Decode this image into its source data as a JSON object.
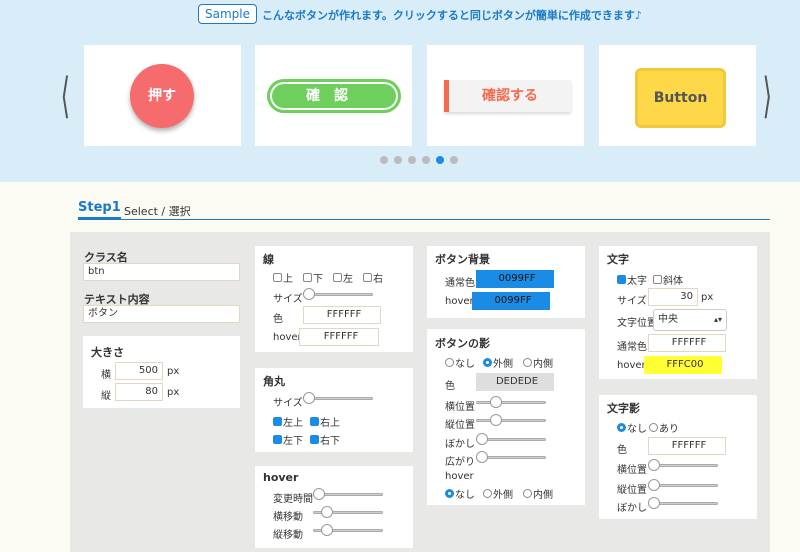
{
  "header": {
    "sample_tag": "Sample",
    "sample_text": "こんなボタンが作れます。クリックすると同じボタンが簡単に作成できます♪"
  },
  "carousel": {
    "prev": "〈",
    "next": "〉",
    "buttons": [
      "押す",
      "確認",
      "確認する",
      "Button"
    ],
    "dots": 6,
    "active_dot": 5
  },
  "step": {
    "number": "Step1",
    "title": "Select /  選択"
  },
  "class_box": {
    "class_label": "クラス名",
    "class_value": "btn",
    "text_label": "テキスト内容",
    "text_value": "ボタン"
  },
  "size_box": {
    "title": "大きさ",
    "width_label": "横",
    "width_value": "500",
    "height_label": "縦",
    "height_value": "80",
    "unit": "px"
  },
  "line_box": {
    "title": "線",
    "sides": [
      "上",
      "下",
      "左",
      "右"
    ],
    "size_label": "サイズ",
    "color_label": "色",
    "color_value": "FFFFFF",
    "hover_label": "hover",
    "hover_value": "FFFFFF"
  },
  "corner_box": {
    "title": "角丸",
    "size_label": "サイズ",
    "corners": [
      "左上",
      "右上",
      "左下",
      "右下"
    ]
  },
  "hover_box": {
    "title": "hover",
    "items": [
      "変更時間",
      "横移動",
      "縦移動"
    ]
  },
  "bg_box": {
    "title": "ボタン背景",
    "normal_label": "通常色",
    "normal_value": "0099FF",
    "hover_label": "hover",
    "hover_value": "0099FF",
    "accent": "#1a8ce5"
  },
  "shadow_box": {
    "title": "ボタンの影",
    "modes": [
      "なし",
      "外側",
      "内側"
    ],
    "color_label": "色",
    "color_value": "DEDEDE",
    "sliders": [
      "横位置",
      "縦位置",
      "ぼかし",
      "広がり"
    ],
    "hover_label": "hover",
    "hover_modes": [
      "なし",
      "外側",
      "内側"
    ]
  },
  "text_box": {
    "title": "文字",
    "bold_label": "太字",
    "italic_label": "斜体",
    "size_label": "サイズ",
    "size_value": "30",
    "unit": "px",
    "align_label": "文字位置",
    "align_value": "中央",
    "normal_label": "通常色",
    "normal_value": "FFFFFF",
    "hover_label": "hover",
    "hover_value": "FFFC00",
    "hover_color": "#ffff33"
  },
  "text_shadow_box": {
    "title": "文字影",
    "modes": [
      "なし",
      "あり"
    ],
    "color_label": "色",
    "color_value": "FFFFFF",
    "sliders": [
      "横位置",
      "縦位置",
      "ぼかし"
    ]
  }
}
